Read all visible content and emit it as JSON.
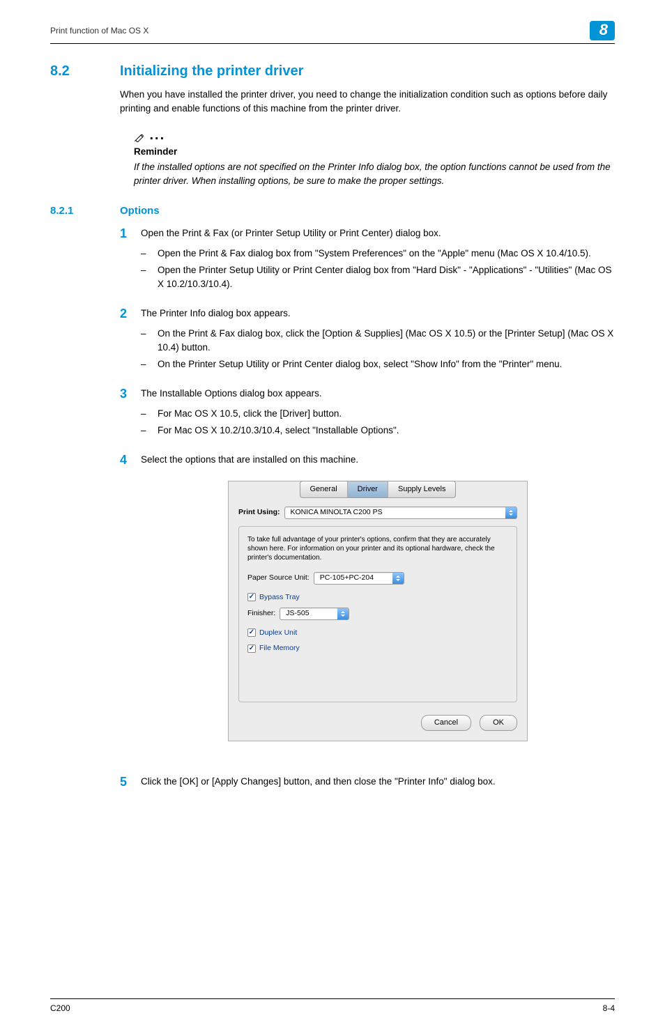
{
  "header": {
    "breadcrumb": "Print function of Mac OS X",
    "chapter": "8"
  },
  "section": {
    "number": "8.2",
    "title": "Initializing the printer driver",
    "intro": "When you have installed the printer driver, you need to change the initialization condition such as options before daily printing and enable functions of this machine from the printer driver."
  },
  "reminder": {
    "label": "Reminder",
    "text": "If the installed options are not specified on the Printer Info dialog box, the option functions cannot be used from the printer driver. When installing options, be sure to make the proper settings."
  },
  "subsection": {
    "number": "8.2.1",
    "title": "Options"
  },
  "steps": [
    {
      "num": "1",
      "text": "Open the Print & Fax (or Printer Setup Utility or Print Center) dialog box.",
      "subs": [
        "Open the Print & Fax dialog box from \"System Preferences\" on the \"Apple\" menu (Mac OS X 10.4/10.5).",
        "Open the Printer Setup Utility or Print Center dialog box from \"Hard Disk\" - \"Applications\" - \"Utilities\" (Mac OS X 10.2/10.3/10.4)."
      ]
    },
    {
      "num": "2",
      "text": "The Printer Info dialog box appears.",
      "subs": [
        "On the Print & Fax dialog box, click the [Option & Supplies] (Mac OS X 10.5) or the [Printer Setup] (Mac OS X 10.4) button.",
        "On the Printer Setup Utility or Print Center dialog box, select \"Show Info\" from the \"Printer\" menu."
      ]
    },
    {
      "num": "3",
      "text": "The Installable Options dialog box appears.",
      "subs": [
        "For Mac OS X 10.5, click the [Driver] button.",
        "For Mac OS X 10.2/10.3/10.4, select \"Installable Options\"."
      ]
    },
    {
      "num": "4",
      "text": "Select the options that are installed on this machine.",
      "subs": []
    },
    {
      "num": "5",
      "text": "Click the [OK] or [Apply Changes] button, and then close the \"Printer Info\" dialog box.",
      "subs": []
    }
  ],
  "dialog": {
    "tabs": {
      "general": "General",
      "driver": "Driver",
      "supply": "Supply Levels"
    },
    "print_using_label": "Print Using:",
    "print_using_value": "KONICA MINOLTA C200 PS",
    "desc": "To take full advantage of your printer's options, confirm that they are accurately shown here. For information on your printer and its optional hardware, check the printer's documentation.",
    "paper_source_label": "Paper Source Unit:",
    "paper_source_value": "PC-105+PC-204",
    "bypass": "Bypass Tray",
    "finisher_label": "Finisher:",
    "finisher_value": "JS-505",
    "duplex": "Duplex Unit",
    "file_memory": "File Memory",
    "cancel": "Cancel",
    "ok": "OK"
  },
  "footer": {
    "left": "C200",
    "right": "8-4"
  }
}
